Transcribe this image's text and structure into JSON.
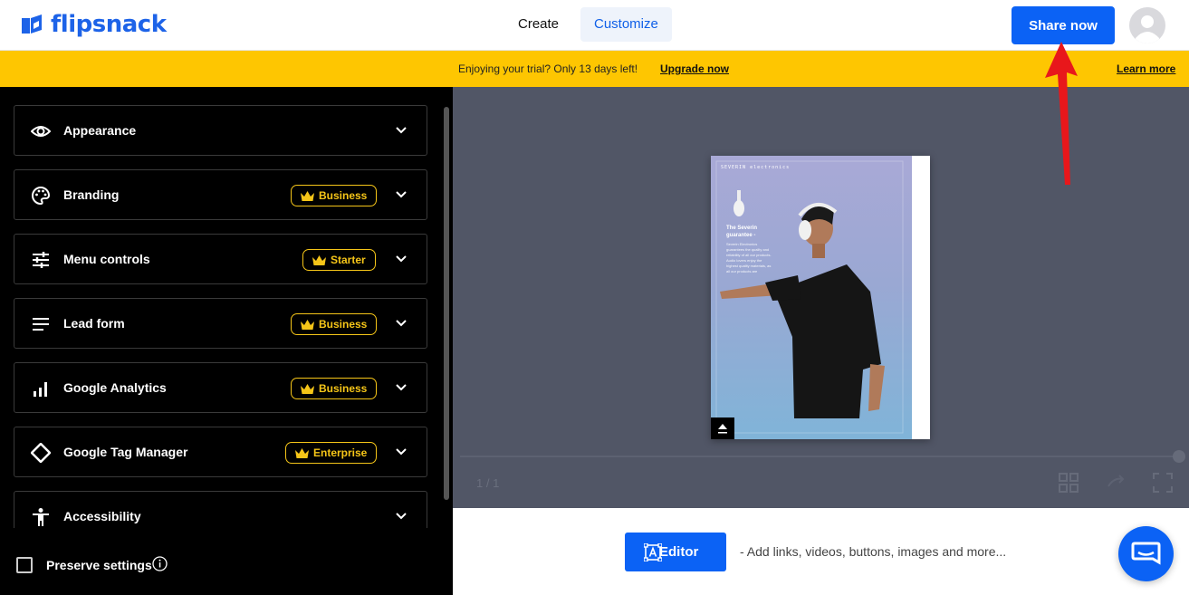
{
  "header": {
    "logo_text": "flipsnack",
    "nav": {
      "create": "Create",
      "customize": "Customize"
    },
    "share_button": "Share now"
  },
  "banner": {
    "text": "Enjoying your trial? Only 13 days left!",
    "upgrade_link": "Upgrade now",
    "learn_more": "Learn more",
    "color": "#fec601"
  },
  "sidebar": {
    "panels": [
      {
        "label": "Appearance",
        "icon": "eye-icon",
        "badge": null
      },
      {
        "label": "Branding",
        "icon": "palette-icon",
        "badge": "Business"
      },
      {
        "label": "Menu controls",
        "icon": "sliders-icon",
        "badge": "Starter"
      },
      {
        "label": "Lead form",
        "icon": "lines-icon",
        "badge": "Business"
      },
      {
        "label": "Google Analytics",
        "icon": "bar-chart-icon",
        "badge": "Business"
      },
      {
        "label": "Google Tag Manager",
        "icon": "diamond-icon",
        "badge": "Enterprise"
      },
      {
        "label": "Accessibility",
        "icon": "person-icon",
        "badge": null
      }
    ],
    "preserve_settings": "Preserve settings",
    "preserve_checked": false,
    "badge_color": "#f5c518"
  },
  "preview": {
    "page_brand": "SEVERIN electronics",
    "page_heading": "The Severin guarantee -",
    "page_paragraph": "Severin Electronics guarantees the quality and reliability of all our products. Audio lovers enjoy the highest quality materials, as all our products are",
    "page_count": "1 / 1"
  },
  "bottom": {
    "editor_button": "Editor",
    "editor_hint": "- Add links, videos, buttons, images and more...",
    "accent_color": "#0b62f5"
  }
}
